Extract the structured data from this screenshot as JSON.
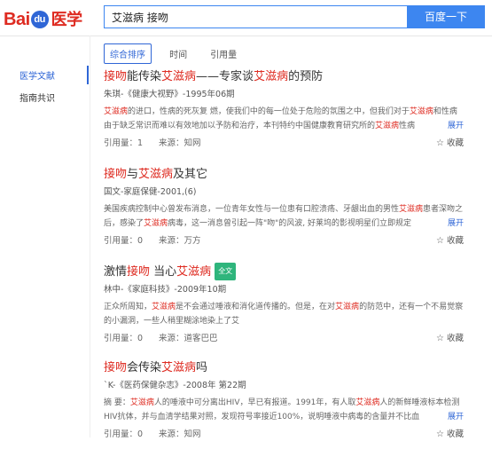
{
  "logo": {
    "part1": "Bai",
    "part2": "du",
    "part3": "医学"
  },
  "search": {
    "query": "艾滋病 接吻",
    "button": "百度一下"
  },
  "sidebar": {
    "items": [
      "医学文献",
      "指南共识"
    ]
  },
  "sort_tabs": [
    "综合排序",
    "时间",
    "引用量"
  ],
  "results": [
    {
      "title_segments": [
        {
          "t": "接吻",
          "h": true
        },
        {
          "t": "能传染",
          "h": false
        },
        {
          "t": "艾滋病",
          "h": true
        },
        {
          "t": "——专家谈",
          "h": false
        },
        {
          "t": "艾滋病",
          "h": true
        },
        {
          "t": "的预防",
          "h": false
        }
      ],
      "badge": "",
      "meta": "朱琪-《健康大视野》-1995年06期",
      "abstract_segments": [
        {
          "t": "艾滋病",
          "h": true
        },
        {
          "t": "的进口，性病的死灰复 燃，使我们中的每一位处于危险的氛围之中，但我们对于",
          "h": false
        },
        {
          "t": "艾滋病",
          "h": true
        },
        {
          "t": "和性病由于缺乏常识而难以有效地加以予防和治疗，本刊特约中国健康教育研究所的",
          "h": false
        },
        {
          "t": "艾滋病",
          "h": true
        },
        {
          "t": "性病",
          "h": false
        }
      ],
      "expand": "展开",
      "cite": "引用量：1",
      "source": "来源：知网",
      "fav": "收藏"
    },
    {
      "title_segments": [
        {
          "t": "接吻",
          "h": true
        },
        {
          "t": "与",
          "h": false
        },
        {
          "t": "艾滋病",
          "h": true
        },
        {
          "t": "及其它",
          "h": false
        }
      ],
      "badge": "",
      "meta": "国文-家庭保健-2001,(6)",
      "abstract_segments": [
        {
          "t": "美国疾病控制中心曾发布消息，一位青年女性与一位患有口腔溃疡、牙龈出血的男性",
          "h": false
        },
        {
          "t": "艾滋病",
          "h": true
        },
        {
          "t": "患者深吻之后，感染了",
          "h": false
        },
        {
          "t": "艾滋病",
          "h": true
        },
        {
          "t": "病毒，这一消息曾引起一阵\"吻\"的风波, 好莱坞的影视明星们立即规定",
          "h": false
        }
      ],
      "expand": "展开",
      "cite": "引用量：0",
      "source": "来源：万方",
      "fav": "收藏"
    },
    {
      "title_segments": [
        {
          "t": "激情",
          "h": false
        },
        {
          "t": "接吻",
          "h": true
        },
        {
          "t": " 当心",
          "h": false
        },
        {
          "t": "艾滋病",
          "h": true
        }
      ],
      "badge": "全文",
      "meta": "林中-《家庭科技》-2009年10期",
      "abstract_segments": [
        {
          "t": "正众所周知，",
          "h": false
        },
        {
          "t": "艾滋病",
          "h": true
        },
        {
          "t": "是不会通过唾液和消化道传播的。但是，在对",
          "h": false
        },
        {
          "t": "艾滋病",
          "h": true
        },
        {
          "t": "的防范中，还有一个不易觉察的小漏洞，一些人稍里糊涂地染上了艾",
          "h": false
        }
      ],
      "expand": "",
      "cite": "引用量：0",
      "source": "来源：道客巴巴",
      "fav": "收藏"
    },
    {
      "title_segments": [
        {
          "t": "接吻",
          "h": true
        },
        {
          "t": "会传染",
          "h": false
        },
        {
          "t": "艾滋病",
          "h": true
        },
        {
          "t": "吗",
          "h": false
        }
      ],
      "badge": "",
      "meta": "`K-《医药保健杂志》-2008年 第22期",
      "abstract_segments": [
        {
          "t": "摘 要：",
          "h": false
        },
        {
          "t": "艾滋病",
          "h": true
        },
        {
          "t": "人的唾液中可分离出HIV，早已有报道。1991年，有人取",
          "h": false
        },
        {
          "t": "艾滋病",
          "h": true
        },
        {
          "t": "人的新鲜唾液标本检测HIV抗体，并与血清学结果对照，发现符号率接近100%，说明唾液中病毒的含量并不比血",
          "h": false
        }
      ],
      "expand": "展开",
      "cite": "引用量：0",
      "source": "来源：知网",
      "fav": "收藏"
    }
  ]
}
